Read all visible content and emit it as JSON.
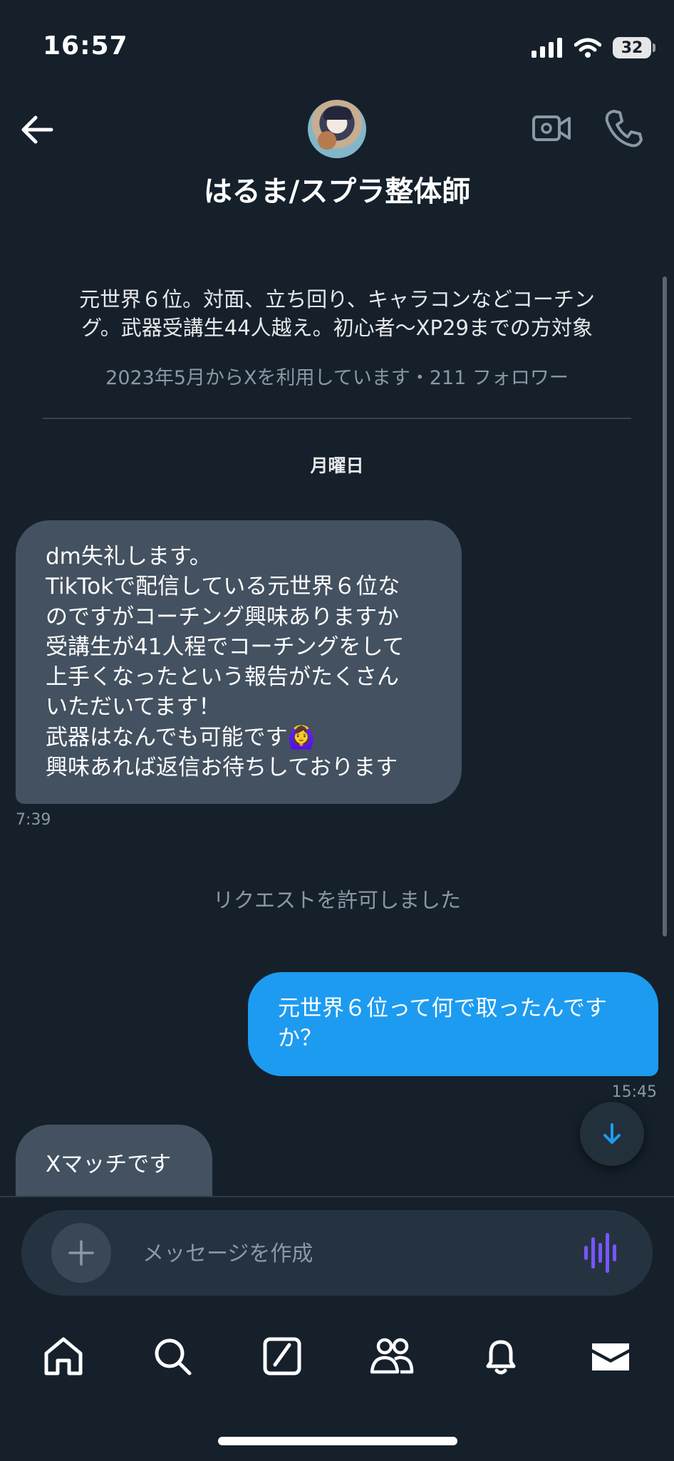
{
  "status_bar": {
    "time": "16:57",
    "battery": "32"
  },
  "header": {
    "name": "はるま/スプラ整体師"
  },
  "profile": {
    "bio": "元世界６位。対面、立ち回り、キャラコンなどコーチン\nグ。武器受講生44人越え。初心者〜XP29までの方対象",
    "meta": "2023年5月からXを利用しています・211 フォロワー"
  },
  "day_label": "月曜日",
  "messages": [
    {
      "direction": "incoming",
      "text": "dm失礼します。\nTikTokで配信している元世界６位な\nのですがコーチング興味ありますか\n受講生が41人程でコーチングをして\n上手くなったという報告がたくさん\nいただいてます！\n武器はなんでも可能です🙆‍♀️\n興味あれば返信お待ちしております",
      "time": "7:39"
    },
    {
      "direction": "system",
      "text": "リクエストを許可しました"
    },
    {
      "direction": "outgoing",
      "text": "元世界６位って何で取ったんです\nか？",
      "time": "15:45"
    },
    {
      "direction": "incoming",
      "text": "Xマッチです"
    }
  ],
  "composer": {
    "placeholder": "メッセージを作成"
  },
  "colors": {
    "background": "#15202b",
    "outgoing_bubble": "#1d9bf0",
    "incoming_bubble": "#435160",
    "voice_accent": "#7856ff"
  },
  "icons": {
    "header": [
      "back-arrow-icon",
      "video-camera-icon",
      "phone-icon"
    ],
    "nav": [
      "home-icon",
      "search-icon",
      "compose-icon",
      "communities-icon",
      "bell-icon",
      "mail-icon"
    ]
  }
}
